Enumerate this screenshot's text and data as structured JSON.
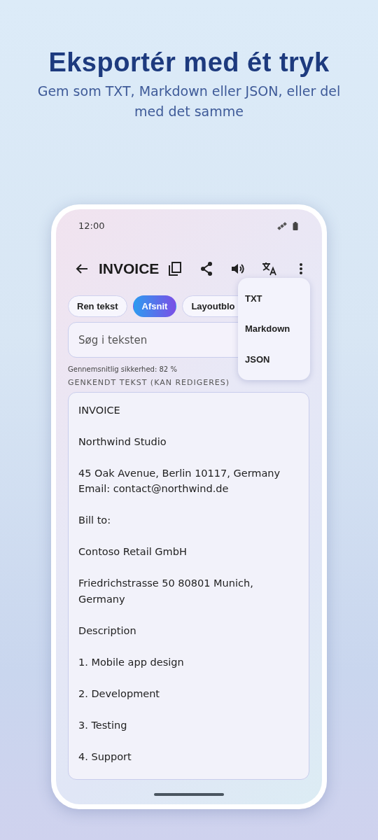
{
  "headline": "Eksportér med ét tryk",
  "subheadline": "Gem som TXT, Markdown eller JSON, eller del med det samme",
  "status_bar": {
    "time": "12:00"
  },
  "toolbar": {
    "title": "INVOICE"
  },
  "chips": [
    {
      "label": "Ren tekst",
      "selected": false
    },
    {
      "label": "Afsnit",
      "selected": true
    },
    {
      "label": "Layoutblo",
      "selected": false
    }
  ],
  "search": {
    "placeholder": "Søg i teksten"
  },
  "confidence": "Gennemsnitlig sikkerhed: 82 %",
  "section_label": "GENKENDT TEKST (KAN REDIGERES)",
  "recognized_text": [
    [
      "INVOICE"
    ],
    [
      "Northwind Studio"
    ],
    [
      "45 Oak Avenue, Berlin 10117, Germany",
      "Email: contact@northwind.de"
    ],
    [
      "Bill to:"
    ],
    [
      "Contoso Retail GmbH"
    ],
    [
      "Friedrichstrasse 50 80801 Munich,",
      "Germany"
    ],
    [
      "Description"
    ],
    [
      "1. Mobile app design"
    ],
    [
      "2. Development"
    ],
    [
      "3. Testing"
    ],
    [
      "4. Support"
    ]
  ],
  "export_menu": [
    {
      "label": "TXT"
    },
    {
      "label": "Markdown"
    },
    {
      "label": "JSON"
    }
  ]
}
